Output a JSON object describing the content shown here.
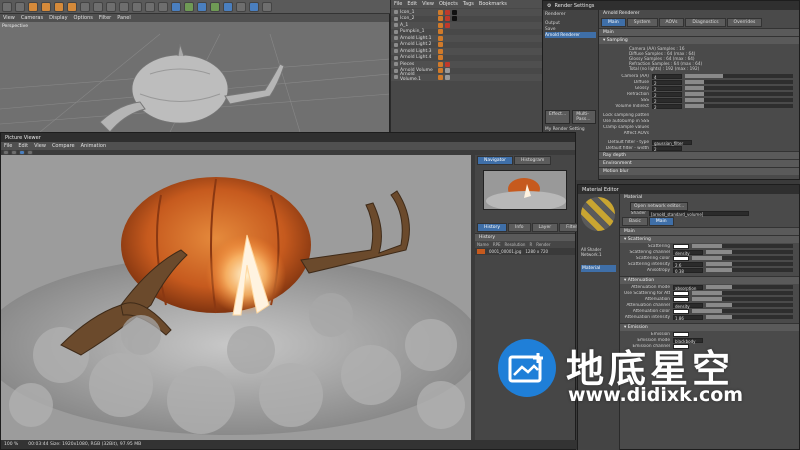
{
  "viewport": {
    "menu": [
      "View",
      "Cameras",
      "Display",
      "Options",
      "Filter",
      "Panel"
    ],
    "label": "Perspective"
  },
  "object_manager": {
    "menu": [
      "File",
      "Edit",
      "View",
      "Objects",
      "Tags",
      "Bookmarks"
    ],
    "objects": [
      "Icon_1",
      "Icon_2",
      "A_1",
      "Pumpkin_1",
      "Arnold Light.1",
      "Arnold Light.2",
      "Arnold Light.3",
      "Arnold Light.4",
      "Pieces",
      "Arnold Volume",
      "Arnold Volume.1"
    ]
  },
  "render_settings": {
    "title": "Render Settings",
    "renderer_label": "Renderer",
    "renderer_value": "Arnold Renderer",
    "tabs": [
      "Main",
      "System",
      "AOVs",
      "Diagnostics",
      "Overrides"
    ],
    "main_label": "Main",
    "sampling_label": "Sampling",
    "sample_info": [
      "Camera (AA) Samples : 16",
      "Diffuse Samples : 64 (max : 64)",
      "Glossy Samples : 64 (max : 64)",
      "Refraction Samples : 64 (max : 64)",
      "Total (no lights) : 192 (max : 192)"
    ],
    "params": [
      {
        "label": "Camera (AA)",
        "value": "4",
        "fill": 0.35
      },
      {
        "label": "Diffuse",
        "value": "2",
        "fill": 0.18
      },
      {
        "label": "Glossy",
        "value": "2",
        "fill": 0.18
      },
      {
        "label": "Refraction",
        "value": "2",
        "fill": 0.18
      },
      {
        "label": "SSS",
        "value": "2",
        "fill": 0.18
      },
      {
        "label": "Volume Indirect",
        "value": "2",
        "fill": 0.18
      }
    ],
    "options": [
      "Lock sampling pattern",
      "Use autobump in SSS",
      "Clamp sample values",
      "Affect AOVs"
    ],
    "filter_label": "Default filter - type",
    "filter_value": "gaussian_filter",
    "filter_width_label": "Default filter - width",
    "filter_width_value": "2",
    "sections": [
      "Ray depth",
      "Environment",
      "Motion blur"
    ],
    "left_items": [
      "Output",
      "Save",
      "Arnold Renderer"
    ],
    "buttons": [
      "Effect...",
      "Multi-Pass..."
    ],
    "my_render_setting": "My Render Setting"
  },
  "picture_viewer": {
    "title": "Picture Viewer",
    "menu": [
      "File",
      "Edit",
      "View",
      "Compare",
      "Animation"
    ],
    "nav_tabs": [
      "Navigator",
      "Histogram"
    ],
    "info_tabs": [
      "History",
      "Info",
      "Layer",
      "Filter",
      "Stereo"
    ],
    "history_label": "History",
    "history_cols": [
      "Name",
      "RPE",
      "Resolution",
      "R",
      "Render"
    ],
    "history_row": {
      "name": "0001_00001.jpg",
      "res": "1280 x 720"
    },
    "status": "00:03:44 Size: 1920x1080, RGB (32Bit), 97.95 MB",
    "zoom": "100 %"
  },
  "material_editor": {
    "title": "Material Editor",
    "header": "Material",
    "open_button": "Open network editor...",
    "shader_label": "Shader",
    "shader_value": "[arnold_standard_volume]",
    "node_label": "All Shader Network.1",
    "material_name": "Material",
    "tabs": [
      "Basic",
      "Main"
    ],
    "main_label": "Main",
    "scattering_section": "Scattering",
    "scattering": [
      {
        "label": "Scattering",
        "value": ""
      },
      {
        "label": "Scattering channel",
        "value": "density"
      },
      {
        "label": "Scattering color",
        "value": ""
      },
      {
        "label": "Scattering intensity",
        "value": "2.6"
      },
      {
        "label": "Anisotropy",
        "value": "0.38"
      }
    ],
    "attenuation_section": "Attenuation",
    "attenuation": [
      {
        "label": "Attenuation mode",
        "value": "absorption"
      },
      {
        "label": "Use Scattering for Attenuation",
        "value": ""
      },
      {
        "label": "Attenuation",
        "value": ""
      },
      {
        "label": "Attenuation channel",
        "value": "density"
      },
      {
        "label": "Attenuation color",
        "value": ""
      },
      {
        "label": "Attenuation intensity",
        "value": "1.86"
      }
    ],
    "emission_section": "Emission",
    "emission": [
      {
        "label": "Emission",
        "value": ""
      },
      {
        "label": "Emission mode",
        "value": "blackbody"
      },
      {
        "label": "Emission channel",
        "value": ""
      }
    ]
  },
  "watermark": {
    "name": "地底星空",
    "url": "www.didixk.com"
  },
  "colors": {
    "accent": "#3f6fa8",
    "brand_blue": "#1f7fd8",
    "pumpkin": "#c65a1e"
  }
}
